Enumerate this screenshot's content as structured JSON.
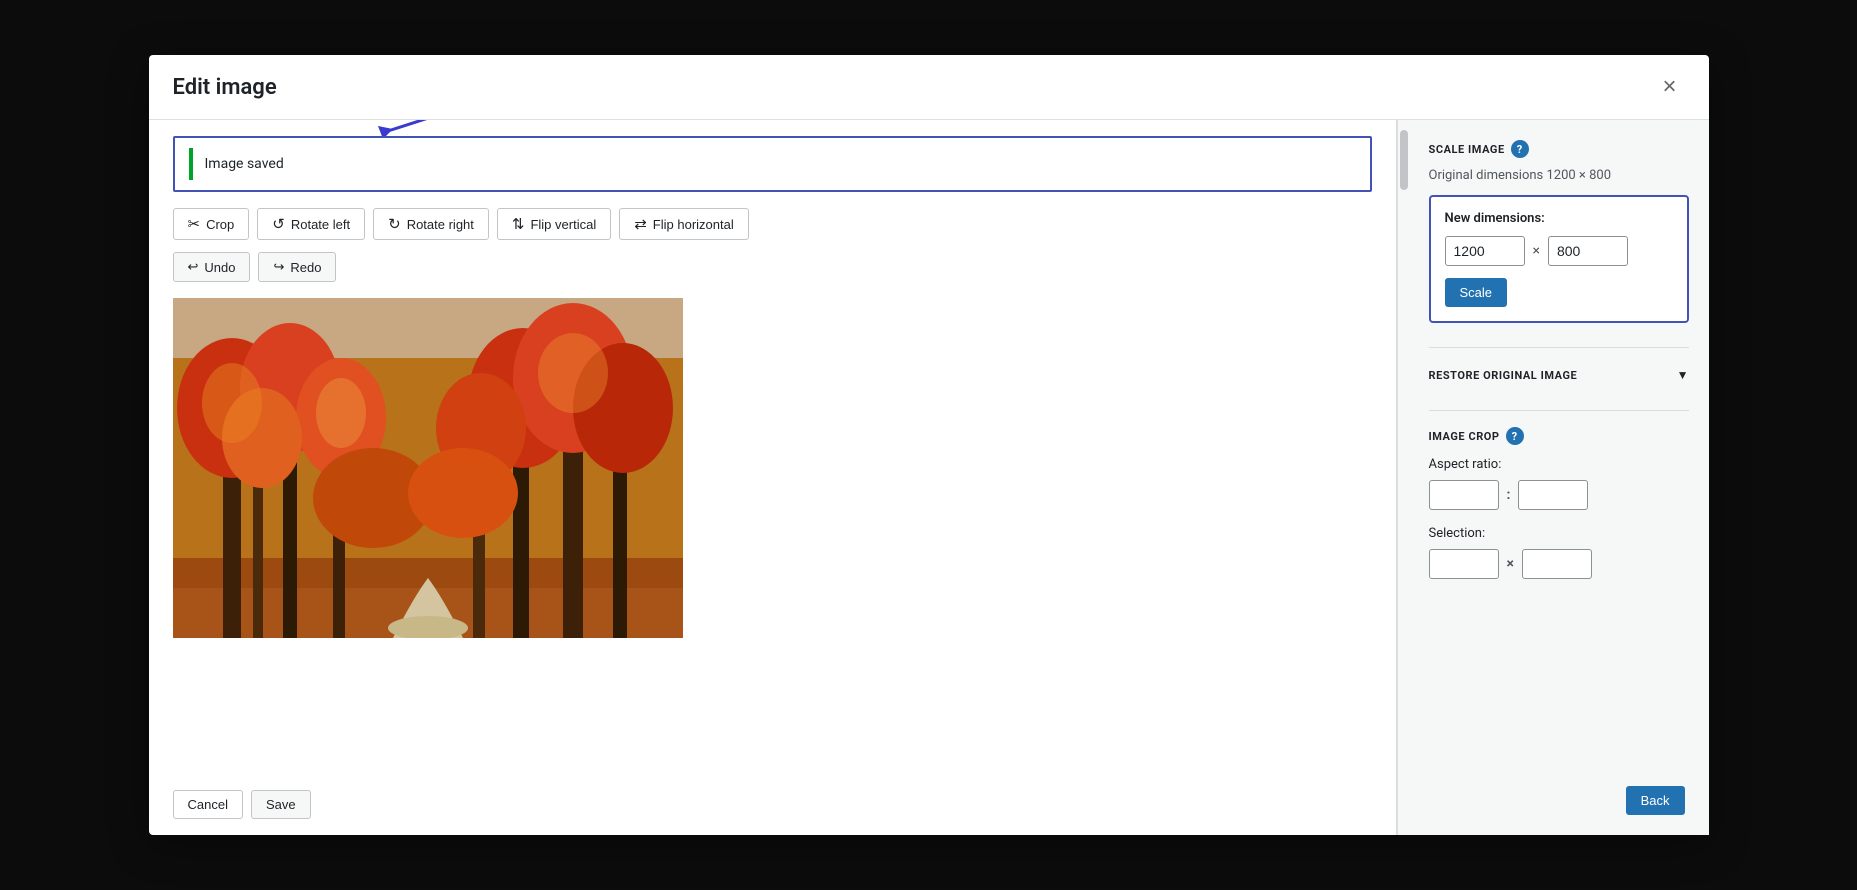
{
  "modal": {
    "title": "Edit image",
    "close_label": "×"
  },
  "notification": {
    "text": "Image saved"
  },
  "toolbar": {
    "crop_label": "Crop",
    "rotate_left_label": "Rotate left",
    "rotate_right_label": "Rotate right",
    "flip_vertical_label": "Flip vertical",
    "flip_horizontal_label": "Flip horizontal"
  },
  "actions": {
    "undo_label": "Undo",
    "redo_label": "Redo"
  },
  "bottom": {
    "cancel_label": "Cancel",
    "save_label": "Save"
  },
  "sidebar": {
    "scale_section_title": "SCALE IMAGE",
    "help_icon_label": "?",
    "original_dims_label": "Original dimensions 1200 × 800",
    "new_dimensions_label": "New dimensions:",
    "width_value": "1200",
    "height_value": "800",
    "scale_button_label": "Scale",
    "restore_section_title": "RESTORE ORIGINAL IMAGE",
    "image_crop_title": "IMAGE CROP",
    "aspect_ratio_label": "Aspect ratio:",
    "aspect_width_value": "",
    "aspect_height_value": "",
    "selection_label": "Selection:",
    "selection_width_value": "",
    "selection_height_value": ""
  },
  "back_button": {
    "label": "Back"
  }
}
